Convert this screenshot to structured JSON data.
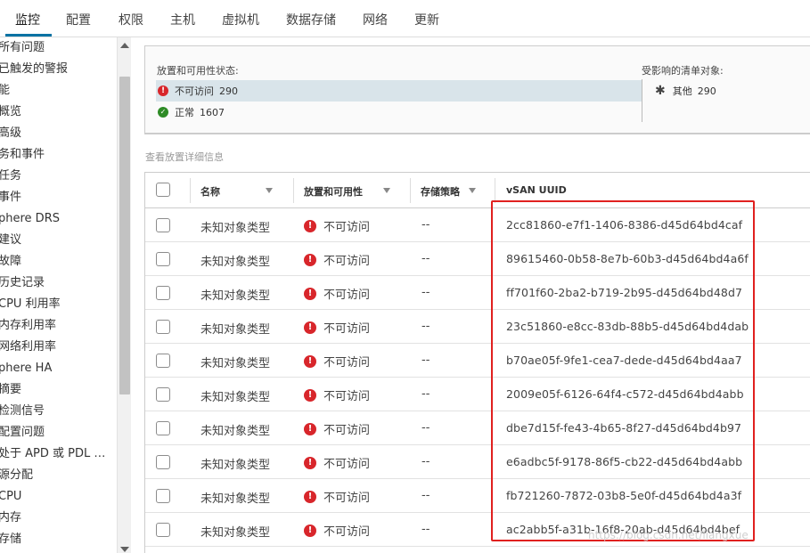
{
  "tabs": [
    "监控",
    "配置",
    "权限",
    "主机",
    "虚拟机",
    "数据存储",
    "网络",
    "更新"
  ],
  "tree": [
    "所有问题",
    "已触发的警报",
    "能",
    "概览",
    "高级",
    "务和事件",
    "任务",
    "事件",
    "phere DRS",
    "建议",
    "故障",
    "历史记录",
    "CPU 利用率",
    "内存利用率",
    "网络利用率",
    "phere HA",
    "摘要",
    "检测信号",
    "配置问题",
    "处于 APD 或 PDL 状…",
    "源分配",
    "CPU",
    "内存",
    "存储"
  ],
  "status": {
    "heading": "放置和可用性状态:",
    "rows": [
      {
        "label": "不可访问",
        "count": "290"
      },
      {
        "label": "正常",
        "count": "1607"
      }
    ],
    "affected_heading": "受影响的清单对象:",
    "affected": {
      "label": "其他",
      "count": "290"
    }
  },
  "detail_link": "查看放置详细信息",
  "grid": {
    "headers": [
      "名称",
      "放置和可用性",
      "存储策略",
      "vSAN UUID"
    ],
    "rows": [
      {
        "name": "未知对象类型",
        "status": "不可访问",
        "policy": "--",
        "uuid": "2cc81860-e7f1-1406-8386-d45d64bd4caf"
      },
      {
        "name": "未知对象类型",
        "status": "不可访问",
        "policy": "--",
        "uuid": "89615460-0b58-8e7b-60b3-d45d64bd4a6f"
      },
      {
        "name": "未知对象类型",
        "status": "不可访问",
        "policy": "--",
        "uuid": "ff701f60-2ba2-b719-2b95-d45d64bd48d7"
      },
      {
        "name": "未知对象类型",
        "status": "不可访问",
        "policy": "--",
        "uuid": "23c51860-e8cc-83db-88b5-d45d64bd4dab"
      },
      {
        "name": "未知对象类型",
        "status": "不可访问",
        "policy": "--",
        "uuid": "b70ae05f-9fe1-cea7-dede-d45d64bd4aa7"
      },
      {
        "name": "未知对象类型",
        "status": "不可访问",
        "policy": "--",
        "uuid": "2009e05f-6126-64f4-c572-d45d64bd4abb"
      },
      {
        "name": "未知对象类型",
        "status": "不可访问",
        "policy": "--",
        "uuid": "dbe7d15f-fe43-4b65-8f27-d45d64bd4b97"
      },
      {
        "name": "未知对象类型",
        "status": "不可访问",
        "policy": "--",
        "uuid": "e6adbc5f-9178-86f5-cb22-d45d64bd4abb"
      },
      {
        "name": "未知对象类型",
        "status": "不可访问",
        "policy": "--",
        "uuid": "fb721260-7872-03b8-5e0f-d45d64bd4a3f"
      },
      {
        "name": "未知对象类型",
        "status": "不可访问",
        "policy": "--",
        "uuid": "ac2abb5f-a31b-16f8-20ab-d45d64bd4bef"
      }
    ]
  },
  "watermark": "https://blog.csdn.net/liangxue"
}
